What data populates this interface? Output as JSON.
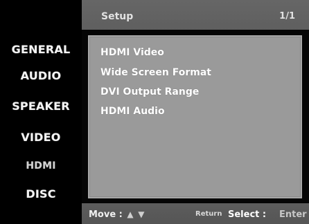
{
  "sidebar": {
    "items": [
      {
        "label": "GENERAL"
      },
      {
        "label": "AUDIO"
      },
      {
        "label": "SPEAKER"
      },
      {
        "label": "VIDEO"
      },
      {
        "label": "HDMI"
      },
      {
        "label": "DISC"
      }
    ]
  },
  "header": {
    "title": "Setup",
    "page": "1/1"
  },
  "menu": {
    "items": [
      {
        "label": "HDMI Video"
      },
      {
        "label": "Wide Screen Format"
      },
      {
        "label": "DVI Output Range"
      },
      {
        "label": "HDMI Audio"
      }
    ]
  },
  "footer": {
    "move_label": "Move :",
    "up_arrow": "▲",
    "down_arrow": "▼",
    "return_label": "Return",
    "select_label": "Select :",
    "enter_label": "Enter"
  }
}
